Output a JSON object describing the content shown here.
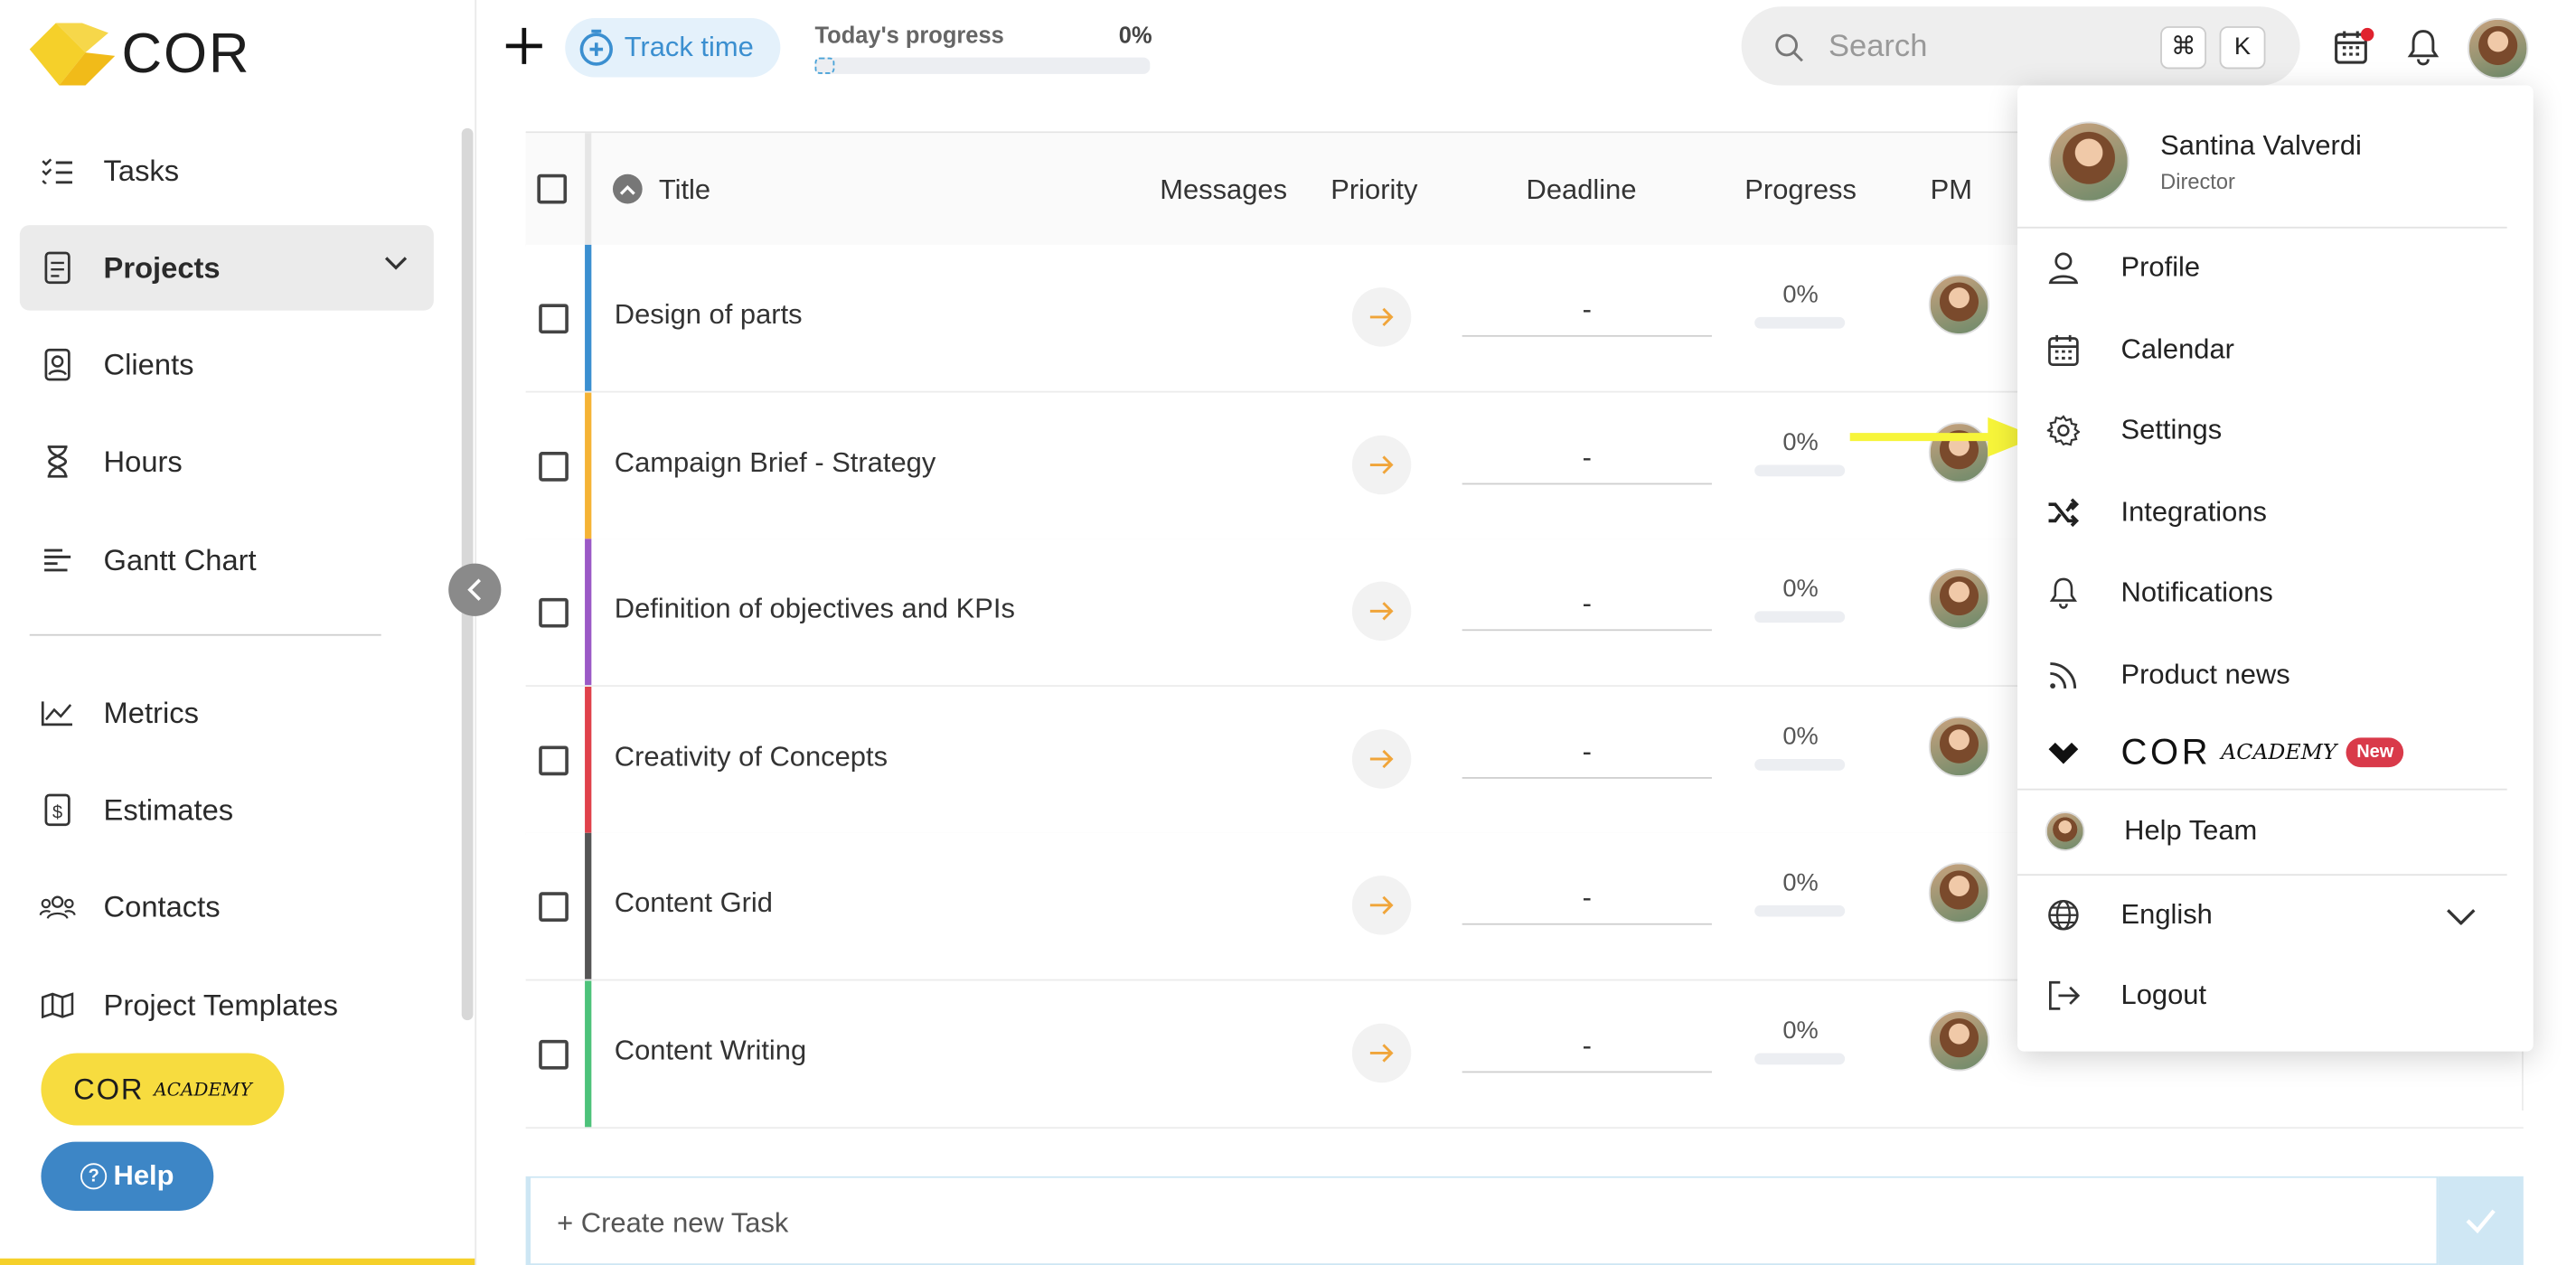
{
  "brand": {
    "logo_text": "COR"
  },
  "sidebar": {
    "items": [
      {
        "label": "Tasks",
        "icon": "tasks-icon"
      },
      {
        "label": "Projects",
        "icon": "projects-icon",
        "active": true
      },
      {
        "label": "Clients",
        "icon": "clients-icon"
      },
      {
        "label": "Hours",
        "icon": "hourglass-icon"
      },
      {
        "label": "Gantt Chart",
        "icon": "gantt-icon"
      },
      {
        "label": "Metrics",
        "icon": "metrics-icon"
      },
      {
        "label": "Estimates",
        "icon": "estimates-icon"
      },
      {
        "label": "Contacts",
        "icon": "contacts-icon"
      },
      {
        "label": "Project Templates",
        "icon": "map-icon"
      }
    ],
    "academy_cor": "COR",
    "academy_word": "ACADEMY",
    "help_label": "Help"
  },
  "topbar": {
    "track_time_label": "Track time",
    "progress_label": "Today's progress",
    "progress_value": "0%",
    "progress_fraction": 0,
    "search_placeholder": "Search",
    "shortcut_cmd": "⌘",
    "shortcut_key": "K"
  },
  "table": {
    "headers": {
      "title": "Title",
      "messages": "Messages",
      "priority": "Priority",
      "deadline": "Deadline",
      "progress": "Progress",
      "pm": "PM"
    },
    "rows": [
      {
        "title": "Design of parts",
        "deadline": "-",
        "progress": "0%",
        "color": "#3b8fd0"
      },
      {
        "title": "Campaign Brief - Strategy",
        "deadline": "-",
        "progress": "0%",
        "color": "#f5b335"
      },
      {
        "title": "Definition of objectives and KPIs",
        "deadline": "-",
        "progress": "0%",
        "color": "#9b59c6"
      },
      {
        "title": "Creativity of Concepts",
        "deadline": "-",
        "progress": "0%",
        "color": "#e0414b"
      },
      {
        "title": "Content Grid",
        "deadline": "-",
        "progress": "0%",
        "color": "#555555"
      },
      {
        "title": "Content Writing",
        "deadline": "-",
        "progress": "0%",
        "color": "#4dc27a"
      }
    ],
    "create_task_label": "+ Create new Task"
  },
  "user_menu": {
    "user_name": "Santina Valverdi",
    "user_role": "Director",
    "items": {
      "profile": "Profile",
      "calendar": "Calendar",
      "settings": "Settings",
      "integrations": "Integrations",
      "notifications": "Notifications",
      "product_news": "Product news",
      "academy_cor": "COR",
      "academy_word": "ACADEMY",
      "new_badge": "New",
      "help_team": "Help Team",
      "language": "English",
      "logout": "Logout"
    }
  },
  "colors": {
    "accent_blue": "#3b8fd0",
    "logo_yellow": "#f5d02a",
    "academy_yellow": "#f7dc3f",
    "help_blue": "#3d86c6",
    "new_badge": "#d93a4a",
    "annotation_arrow": "#f7f53a"
  }
}
